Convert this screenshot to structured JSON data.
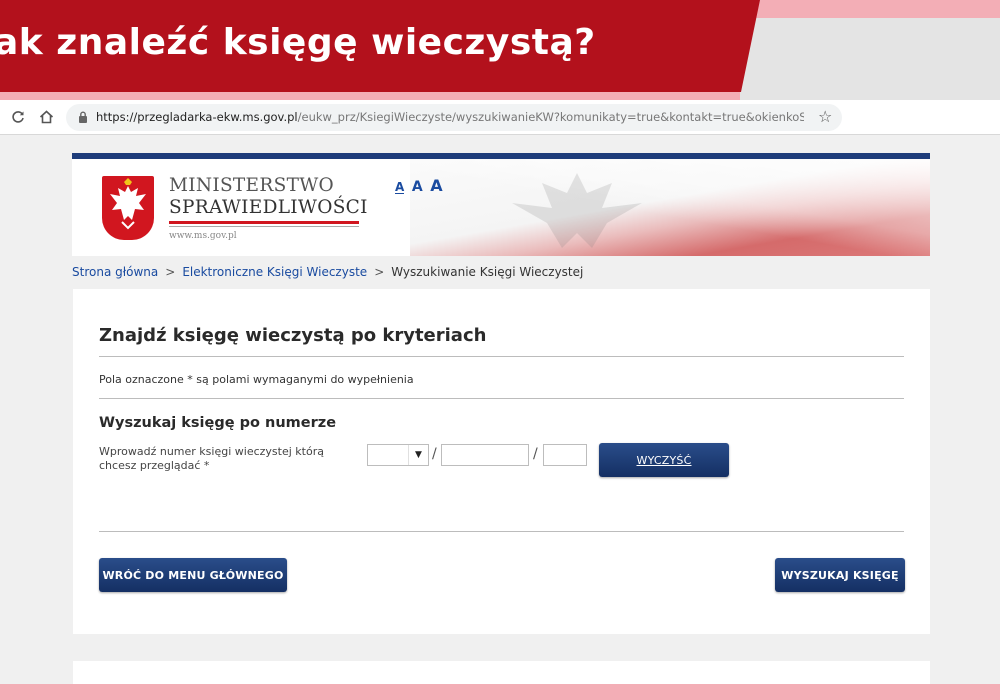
{
  "overlay": {
    "title": "ak znaleźć księgę wieczystą?"
  },
  "browser": {
    "url_host": "https://przegladarka-ekw.ms.gov.pl",
    "url_path": "/eukw_prz/KsiegiWieczyste/wyszukiwanieKW?komunikaty=true&kontakt=true&okienkoSerwis..."
  },
  "header": {
    "ministry_line1": "MINISTERSTWO",
    "ministry_line2": "SPRAWIEDLIWOŚCI",
    "ministry_url": "www.ms.gov.pl",
    "font_sizes": [
      "A",
      "A",
      "A"
    ]
  },
  "breadcrumb": {
    "items": [
      "Strona główna",
      "Elektroniczne Księgi Wieczyste",
      "Wyszukiwanie Księgi Wieczystej"
    ],
    "separator": ">"
  },
  "form": {
    "title": "Znajdź księgę wieczystą po kryteriach",
    "required_note": "Pola oznaczone * są polami wymaganymi do wypełnienia",
    "section_title": "Wyszukaj księgę po numerze",
    "field_label": "Wprowadź numer księgi wieczystej którą chcesz przeglądać *",
    "separator": "/",
    "select_value": "",
    "number_value": "",
    "check_digit_value": "",
    "clear_button": "WYCZYŚĆ",
    "back_button": "WRÓĆ DO MENU GŁÓWNEGO",
    "search_button": "WYSZUKAJ KSIĘGĘ"
  },
  "colors": {
    "banner_red": "#b3111c",
    "pink_strip": "#f3aeb6",
    "navy": "#1e3c7a",
    "link_blue": "#1a4ba0"
  },
  "icons": [
    "reload-icon",
    "home-icon",
    "lock-icon",
    "star-icon",
    "chevron-down-icon",
    "eagle-emblem-icon"
  ]
}
